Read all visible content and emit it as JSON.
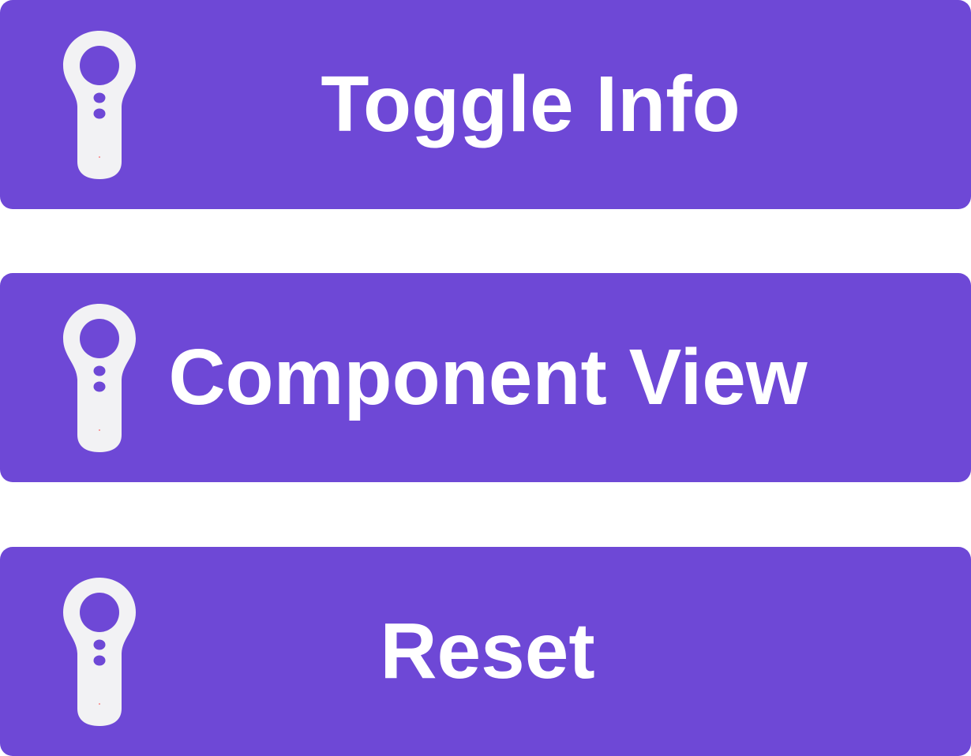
{
  "menu": {
    "accent_color": "#6e48d6",
    "icon": "vr-controller-icon",
    "buttons": [
      {
        "label": "Toggle Info"
      },
      {
        "label": "Component View"
      },
      {
        "label": "Reset"
      }
    ]
  }
}
